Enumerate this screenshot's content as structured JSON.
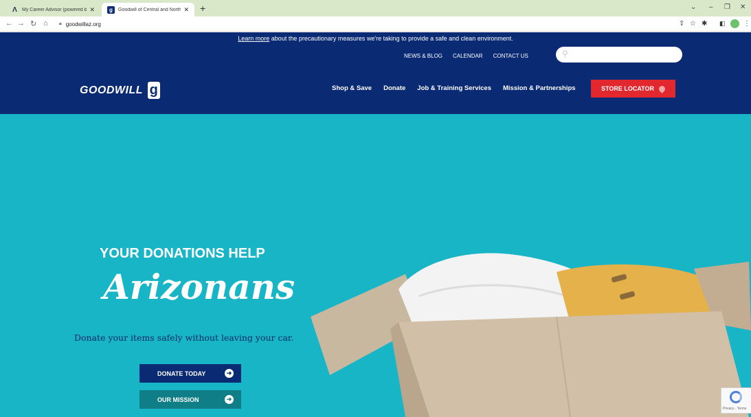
{
  "browser": {
    "tabs": [
      {
        "title": "My Career Advisor (powered by",
        "favicon": "a-logo-icon"
      },
      {
        "title": "Goodwill of Central and Northern",
        "favicon": "goodwill-g-icon"
      }
    ],
    "url": "goodwillaz.org"
  },
  "page": {
    "notice": {
      "link": "Learn more",
      "text": " about the precautionary measures we're taking to provide a safe and clean environment."
    },
    "top_links": [
      "NEWS & BLOG",
      "CALENDAR",
      "CONTACT US"
    ],
    "search": {
      "placeholder": ""
    },
    "logo": {
      "text": "GOODWILL",
      "mark": "g"
    },
    "nav": [
      "Shop & Save",
      "Donate",
      "Job & Training Services",
      "Mission & Partnerships"
    ],
    "store_locator": "STORE LOCATOR",
    "hero": {
      "subtitle": "YOUR DONATIONS HELP",
      "title": "Arizonans",
      "description": "Donate your items safely without leaving your car.",
      "donate_button": "DONATE TODAY",
      "mission_button": "OUR MISSION"
    },
    "recaptcha": "Privacy - Terms"
  },
  "colors": {
    "header_navy": "#0a2a74",
    "hero_teal": "#18b5c7",
    "store_red": "#e0282e",
    "mission_teal": "#0f7e86",
    "tabbar_green": "#d9e8c9"
  }
}
